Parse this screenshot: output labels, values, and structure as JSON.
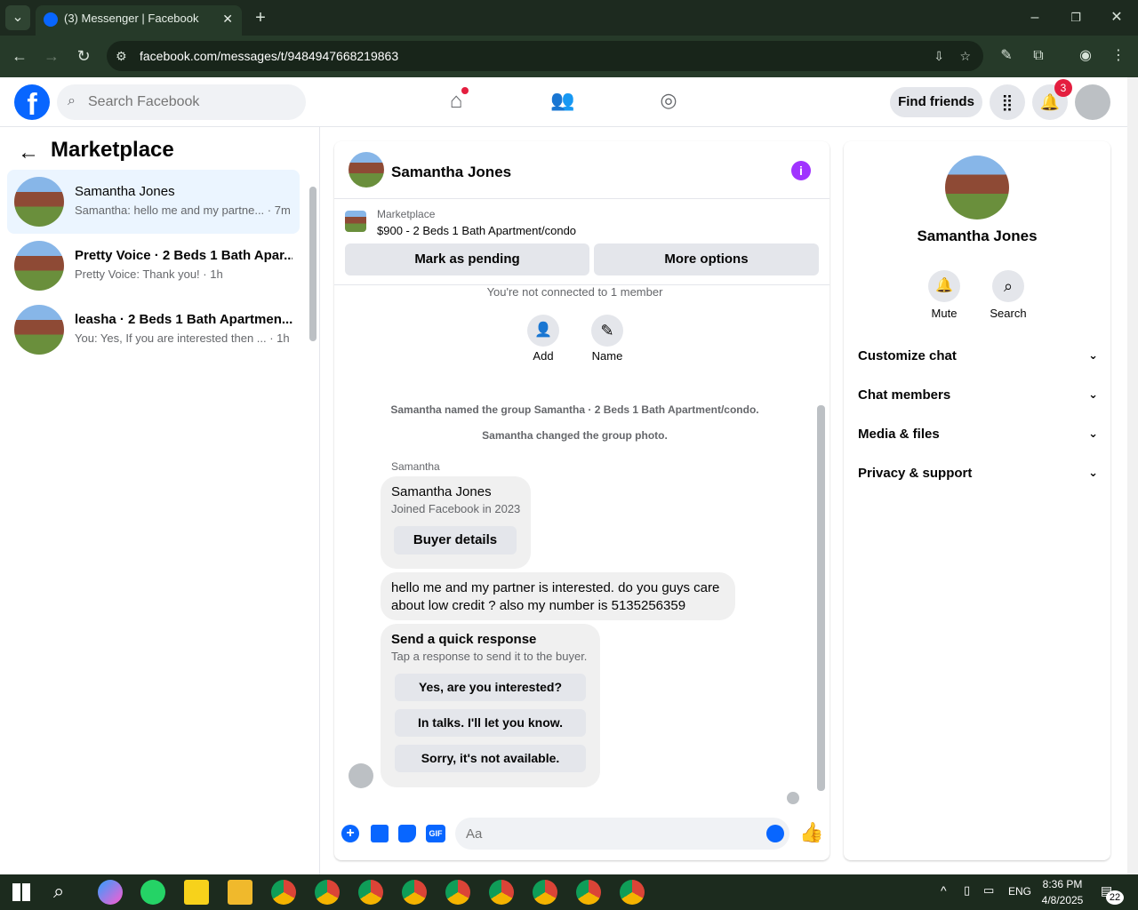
{
  "browser": {
    "tab_title": "(3) Messenger | Facebook",
    "url": "facebook.com/messages/t/9484947668219863"
  },
  "fb": {
    "search_placeholder": "Search Facebook",
    "find_friends": "Find friends",
    "notif_count": "3"
  },
  "left": {
    "title": "Marketplace",
    "conversations": [
      {
        "name": "Samantha Jones",
        "preview": "Samantha: hello me and my partne... · 7m"
      },
      {
        "name": "Pretty Voice · 2 Beds 1 Bath Apar...",
        "preview": "Pretty Voice: Thank you! · 1h"
      },
      {
        "name": "leasha · 2 Beds 1 Bath Apartmen...",
        "preview": "You: Yes, If you are interested then ... · 1h"
      }
    ]
  },
  "chat": {
    "header_name": "Samantha Jones",
    "listing_label": "Marketplace",
    "listing_title": "$900 - 2 Beds 1 Bath Apartment/condo",
    "mark_pending": "Mark as pending",
    "more_options": "More options",
    "not_connected": "You're not connected to 1 member",
    "add_label": "Add",
    "name_label": "Name",
    "sys1": "Samantha named the group Samantha · 2 Beds 1 Bath Apartment/condo.",
    "sys2": "Samantha changed the group photo.",
    "sender": "Samantha",
    "card_name": "Samantha Jones",
    "card_sub": "Joined Facebook in 2023",
    "buyer_details": "Buyer details",
    "message": "hello me and my partner is interested. do you guys care about low credit ? also my number is 5135256359",
    "quick_title": "Send a quick response",
    "quick_sub": "Tap a response to send it to the buyer.",
    "quick_responses": [
      "Yes, are you interested?",
      "In talks. I'll let you know.",
      "Sorry, it's not available."
    ],
    "input_placeholder": "Aa"
  },
  "right": {
    "name": "Samantha Jones",
    "mute": "Mute",
    "search": "Search",
    "sections": [
      "Customize chat",
      "Chat members",
      "Media & files",
      "Privacy & support"
    ]
  },
  "taskbar": {
    "lang": "ENG",
    "time": "8:36 PM",
    "date": "4/8/2025",
    "notif_count": "22"
  },
  "colors": {
    "fb_blue": "#0866ff",
    "purple": "#a033ff",
    "badge_red": "#e41e3f"
  }
}
